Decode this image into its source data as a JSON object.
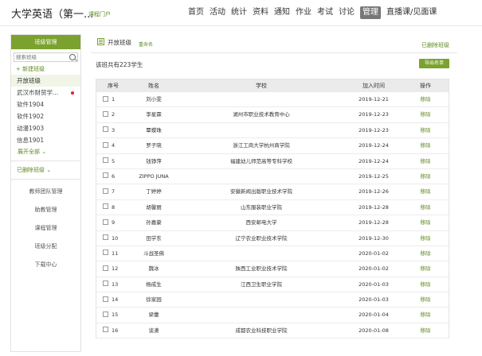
{
  "header": {
    "course_title": "大学英语（第一...",
    "portal_link": "课程门户",
    "nav": [
      "首页",
      "活动",
      "统计",
      "资料",
      "通知",
      "作业",
      "考试",
      "讨论",
      "管理",
      "直播课/见面课"
    ],
    "active_nav": "管理"
  },
  "sidebar": {
    "title": "班级管理",
    "search_placeholder": "搜索班级",
    "new_class": "+ 新建班级",
    "classes": [
      "开放班级",
      "武汉市财贸学...",
      "软件1904",
      "软件1902",
      "动漫1903",
      "信息1901"
    ],
    "expand_all": "展开全部 ⌄",
    "deleted_classes": "已删除班级 ⌄",
    "menu": [
      "教师团队管理",
      "助教管理",
      "课程管理",
      "班级分配",
      "下载中心"
    ]
  },
  "main": {
    "class_name": "开放班级",
    "rename": "重命名",
    "deleted_link": "已删除班级",
    "total_text": "该班共有223学生",
    "export_button": "导出名单",
    "columns": [
      "序号",
      "姓名",
      "学校",
      "加入时间",
      "操作"
    ],
    "rows": [
      {
        "no": "1",
        "name": "刘小雯",
        "school": "",
        "time": "2019-12-21",
        "op": "移除"
      },
      {
        "no": "2",
        "name": "李星霖",
        "school": "湖州市职业技术教育中心",
        "time": "2019-12-23",
        "op": "移除"
      },
      {
        "no": "3",
        "name": "覃蝶珠",
        "school": "",
        "time": "2019-12-23",
        "op": "移除"
      },
      {
        "no": "4",
        "name": "罗子晓",
        "school": "浙江工商大学杭州商学院",
        "time": "2019-12-24",
        "op": "移除"
      },
      {
        "no": "5",
        "name": "钱铮萍",
        "school": "福建幼儿师范高等专科学校",
        "time": "2019-12-24",
        "op": "移除"
      },
      {
        "no": "6",
        "name": "ZIPPO JUNA",
        "school": "",
        "time": "2019-12-25",
        "op": "移除"
      },
      {
        "no": "7",
        "name": "丁婷婷",
        "school": "安徽新闻出版职业技术学院",
        "time": "2019-12-26",
        "op": "移除"
      },
      {
        "no": "8",
        "name": "胡馨丽",
        "school": "山东服装职业学院",
        "time": "2019-12-28",
        "op": "移除"
      },
      {
        "no": "9",
        "name": "孙嘉豪",
        "school": "西安邮电大学",
        "time": "2019-12-28",
        "op": "移除"
      },
      {
        "no": "10",
        "name": "田学东",
        "school": "辽宁农业职业技术学院",
        "time": "2019-12-30",
        "op": "移除"
      },
      {
        "no": "11",
        "name": "斗战圣佛",
        "school": "",
        "time": "2020-01-02",
        "op": "移除"
      },
      {
        "no": "12",
        "name": "魏冰",
        "school": "陕西工业职业技术学院",
        "time": "2020-01-02",
        "op": "移除"
      },
      {
        "no": "13",
        "name": "杨成生",
        "school": "江西卫生职业学院",
        "time": "2020-01-03",
        "op": "移除"
      },
      {
        "no": "14",
        "name": "徐家园",
        "school": "",
        "time": "2020-01-03",
        "op": "移除"
      },
      {
        "no": "15",
        "name": "梁蕾",
        "school": "",
        "time": "2020-01-04",
        "op": "移除"
      },
      {
        "no": "16",
        "name": "谈潇",
        "school": "成都农业科技职业学院",
        "time": "2020-01-08",
        "op": "移除"
      }
    ]
  }
}
